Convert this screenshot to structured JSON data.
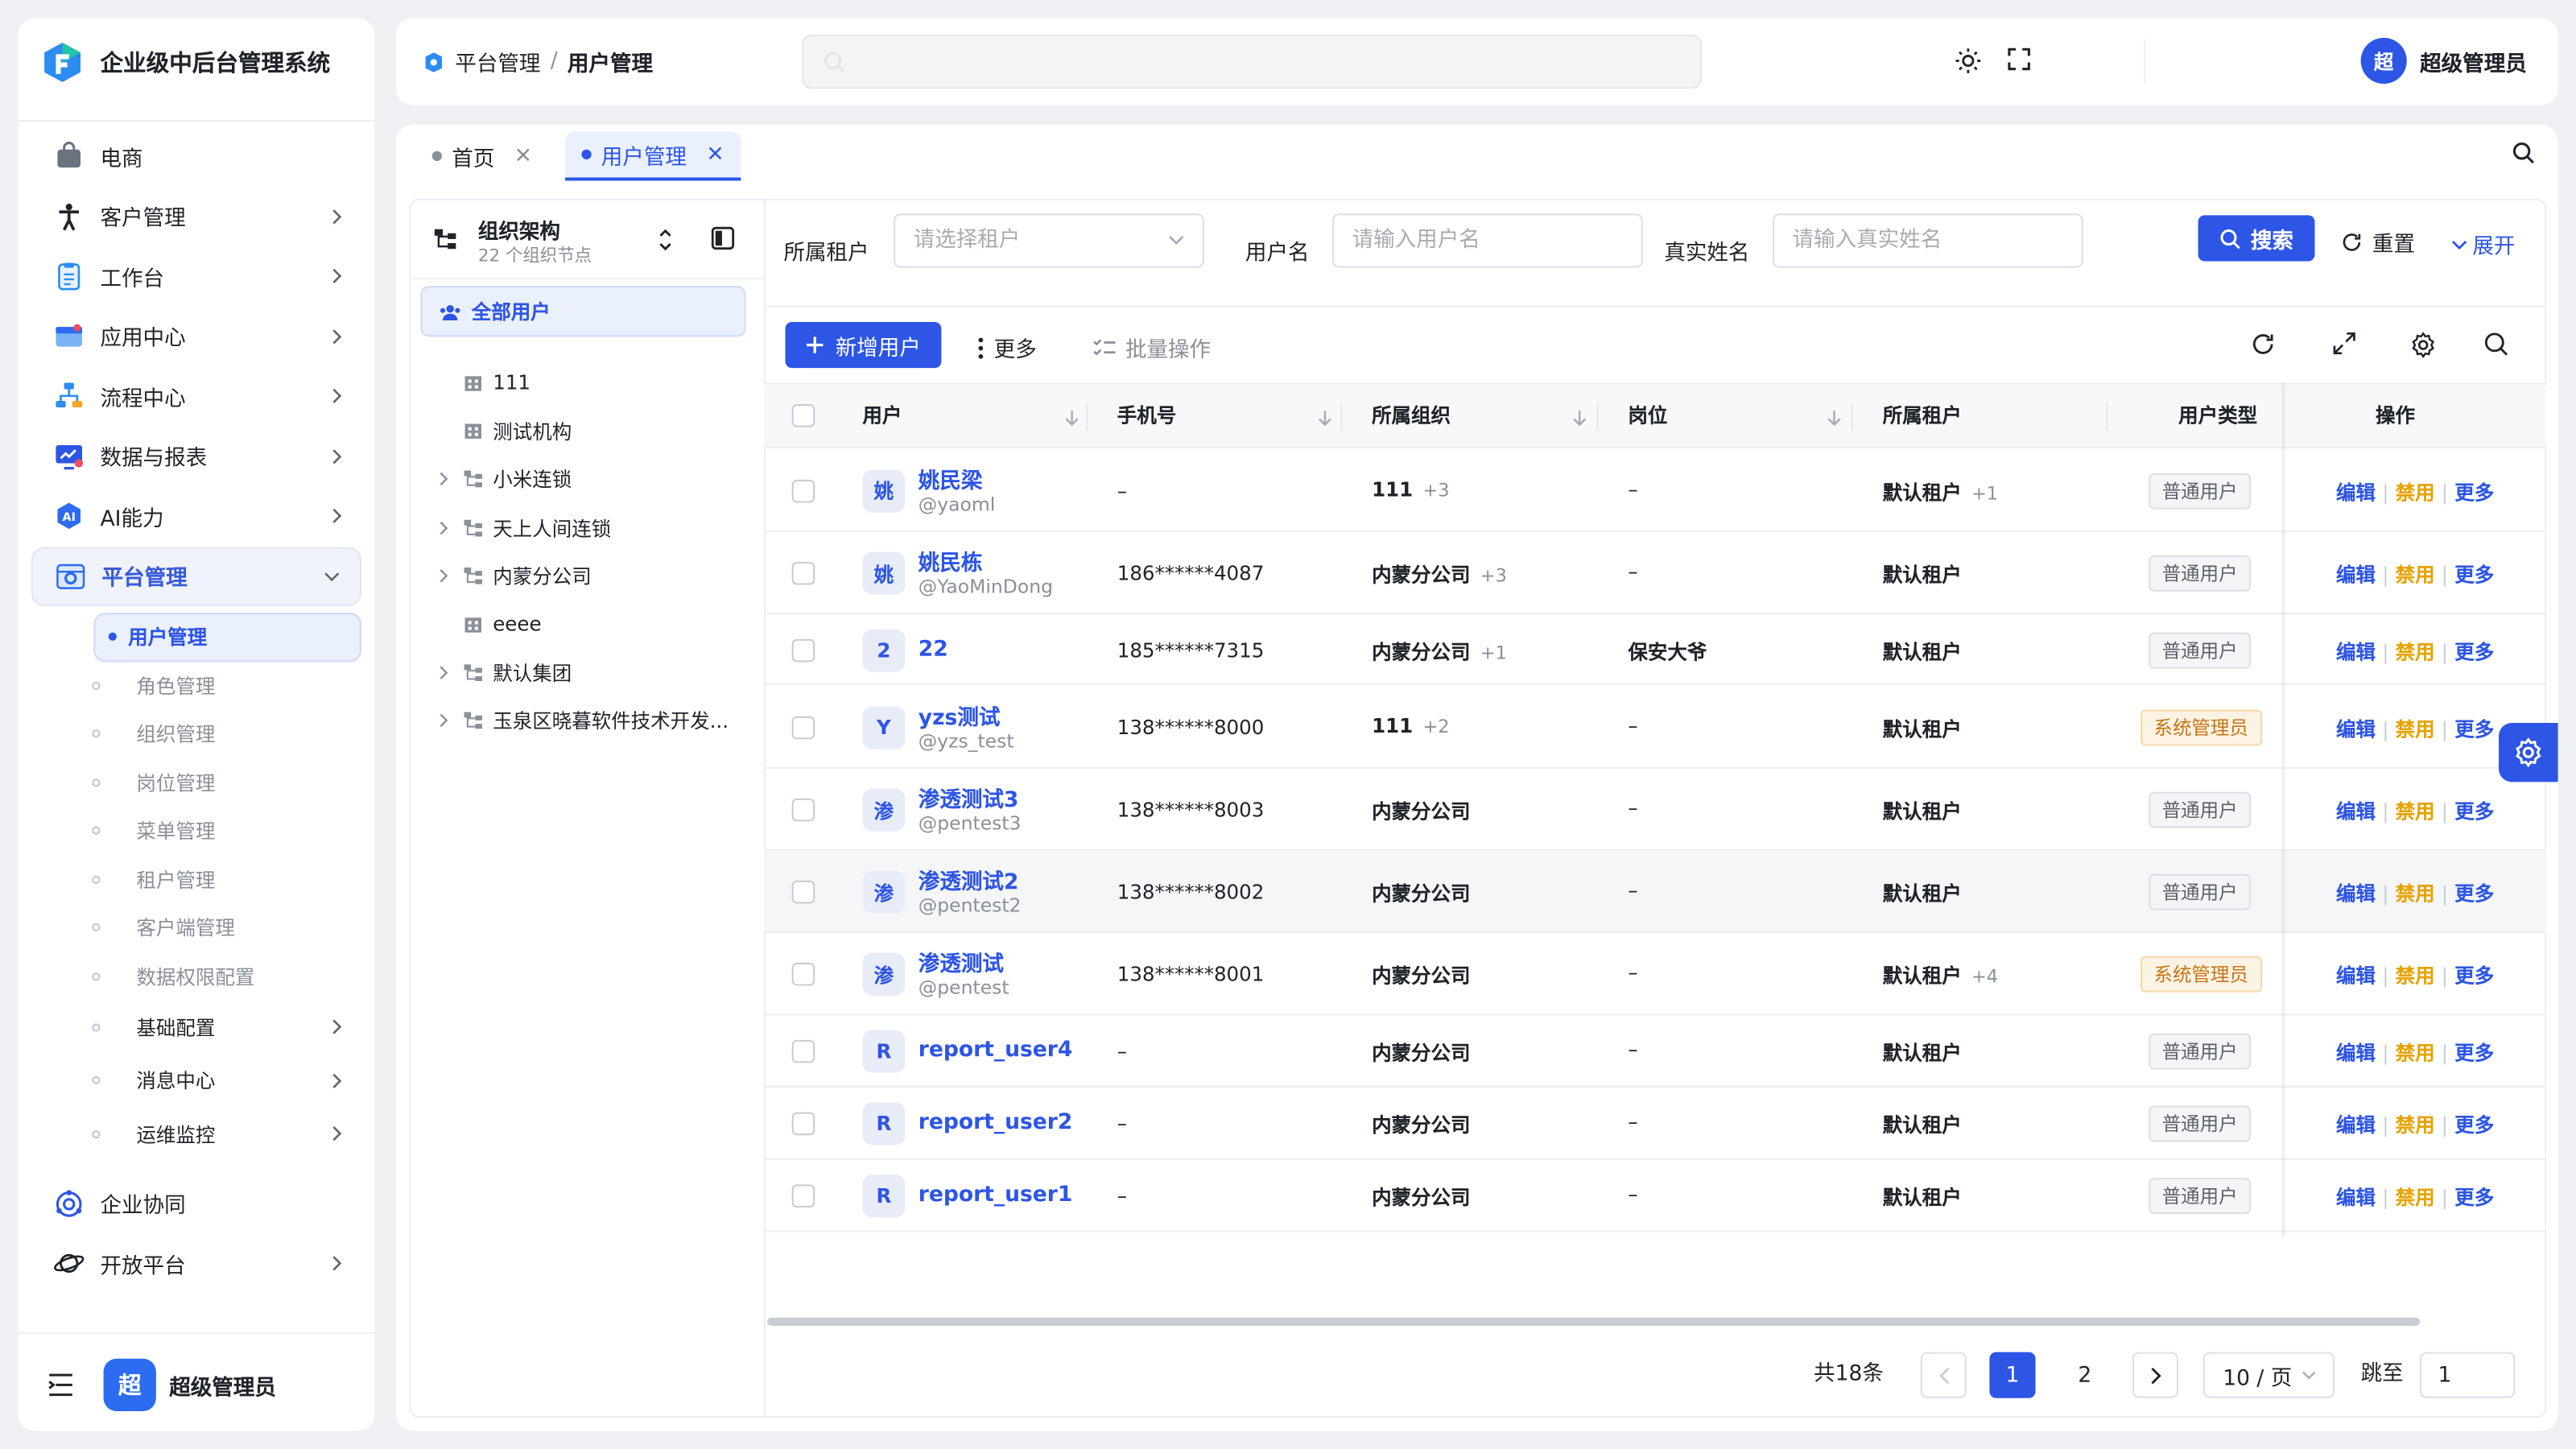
{
  "app": {
    "title": "企业级中后台管理系统"
  },
  "sidebar": {
    "items": [
      {
        "label": "电商",
        "icon": "shopping-bag-icon",
        "arrow": false
      },
      {
        "label": "客户管理",
        "icon": "person-icon",
        "arrow": true
      },
      {
        "label": "工作台",
        "icon": "clipboard-icon",
        "arrow": true
      },
      {
        "label": "应用中心",
        "icon": "app-window-icon",
        "arrow": true
      },
      {
        "label": "流程中心",
        "icon": "flow-icon",
        "arrow": true
      },
      {
        "label": "数据与报表",
        "icon": "chart-screen-icon",
        "arrow": true
      },
      {
        "label": "AI能力",
        "icon": "ai-icon",
        "arrow": true
      },
      {
        "label": "平台管理",
        "icon": "platform-gear-icon",
        "arrow": true,
        "expanded": true
      }
    ],
    "sub_items": [
      {
        "label": "用户管理",
        "active": true
      },
      {
        "label": "角色管理"
      },
      {
        "label": "组织管理"
      },
      {
        "label": "岗位管理"
      },
      {
        "label": "菜单管理"
      },
      {
        "label": "租户管理"
      },
      {
        "label": "客户端管理"
      },
      {
        "label": "数据权限配置"
      },
      {
        "label": "基础配置",
        "strong": true,
        "arrow": true
      },
      {
        "label": "消息中心",
        "strong": true,
        "arrow": true
      },
      {
        "label": "运维监控",
        "strong": true,
        "arrow": true
      }
    ],
    "bottom_items": [
      {
        "label": "企业协同",
        "icon": "collaboration-icon",
        "arrow": false
      },
      {
        "label": "开放平台",
        "icon": "planet-icon",
        "arrow": true
      }
    ],
    "footer": {
      "avatar_text": "超",
      "user_name": "超级管理员"
    }
  },
  "header": {
    "breadcrumb": [
      "平台管理",
      "用户管理"
    ],
    "user": {
      "avatar_text": "超",
      "name": "超级管理员"
    }
  },
  "tabs": [
    {
      "label": "首页",
      "active": false
    },
    {
      "label": "用户管理",
      "active": true
    }
  ],
  "tree": {
    "title": "组织架构",
    "subtitle": "22 个组织节点",
    "all_label": "全部用户",
    "nodes": [
      {
        "label": "111",
        "expandable": false,
        "icon": "building-icon"
      },
      {
        "label": "测试机构",
        "expandable": false,
        "icon": "building-icon"
      },
      {
        "label": "小米连锁",
        "expandable": true,
        "icon": "org-tree-icon"
      },
      {
        "label": "天上人间连锁",
        "expandable": true,
        "icon": "org-tree-icon"
      },
      {
        "label": "内蒙分公司",
        "expandable": true,
        "icon": "org-tree-icon"
      },
      {
        "label": "eeee",
        "expandable": false,
        "icon": "building-icon"
      },
      {
        "label": "默认集团",
        "expandable": true,
        "icon": "org-tree-icon"
      },
      {
        "label": "玉泉区晓暮软件技术开发...",
        "expandable": true,
        "icon": "org-tree-icon"
      }
    ]
  },
  "filter": {
    "tenant_label": "所属租户",
    "tenant_placeholder": "请选择租户",
    "username_label": "用户名",
    "username_placeholder": "请输入用户名",
    "realname_label": "真实姓名",
    "realname_placeholder": "请输入真实姓名",
    "search_label": "搜索",
    "reset_label": "重置",
    "expand_label": "展开"
  },
  "toolbar": {
    "add_label": "新增用户",
    "more_label": "更多",
    "batch_label": "批量操作"
  },
  "table": {
    "columns": [
      "用户",
      "手机号",
      "所属组织",
      "岗位",
      "所属租户",
      "用户类型",
      "操作"
    ],
    "rows": [
      {
        "avatar": "姚",
        "name": "姚民梁",
        "handle": "@yaoml",
        "phone": "–",
        "org": "111",
        "org_extra": "+3",
        "post": "–",
        "tenant": "默认租户",
        "tenant_extra": "+1",
        "type": "普通用户",
        "admin": false
      },
      {
        "avatar": "姚",
        "name": "姚民栋",
        "handle": "@YaoMinDong",
        "phone": "186******4087",
        "org": "内蒙分公司",
        "org_extra": "+3",
        "post": "–",
        "tenant": "默认租户",
        "tenant_extra": "",
        "type": "普通用户",
        "admin": false
      },
      {
        "avatar": "2",
        "name": "22",
        "handle": "",
        "phone": "185******7315",
        "org": "内蒙分公司",
        "org_extra": "+1",
        "post": "保安大爷",
        "tenant": "默认租户",
        "tenant_extra": "",
        "type": "普通用户",
        "admin": false
      },
      {
        "avatar": "Y",
        "name": "yzs测试",
        "handle": "@yzs_test",
        "phone": "138******8000",
        "org": "111",
        "org_extra": "+2",
        "post": "–",
        "tenant": "默认租户",
        "tenant_extra": "",
        "type": "系统管理员",
        "admin": true
      },
      {
        "avatar": "渗",
        "name": "渗透测试3",
        "handle": "@pentest3",
        "phone": "138******8003",
        "org": "内蒙分公司",
        "org_extra": "",
        "post": "–",
        "tenant": "默认租户",
        "tenant_extra": "",
        "type": "普通用户",
        "admin": false
      },
      {
        "avatar": "渗",
        "name": "渗透测试2",
        "handle": "@pentest2",
        "phone": "138******8002",
        "org": "内蒙分公司",
        "org_extra": "",
        "post": "–",
        "tenant": "默认租户",
        "tenant_extra": "",
        "type": "普通用户",
        "admin": false
      },
      {
        "avatar": "渗",
        "name": "渗透测试",
        "handle": "@pentest",
        "phone": "138******8001",
        "org": "内蒙分公司",
        "org_extra": "",
        "post": "–",
        "tenant": "默认租户",
        "tenant_extra": "+4",
        "type": "系统管理员",
        "admin": true
      },
      {
        "avatar": "R",
        "name": "report_user4",
        "handle": "",
        "phone": "–",
        "org": "内蒙分公司",
        "org_extra": "",
        "post": "–",
        "tenant": "默认租户",
        "tenant_extra": "",
        "type": "普通用户",
        "admin": false
      },
      {
        "avatar": "R",
        "name": "report_user2",
        "handle": "",
        "phone": "–",
        "org": "内蒙分公司",
        "org_extra": "",
        "post": "–",
        "tenant": "默认租户",
        "tenant_extra": "",
        "type": "普通用户",
        "admin": false
      },
      {
        "avatar": "R",
        "name": "report_user1",
        "handle": "",
        "phone": "–",
        "org": "内蒙分公司",
        "org_extra": "",
        "post": "–",
        "tenant": "默认租户",
        "tenant_extra": "",
        "type": "普通用户",
        "admin": false
      }
    ],
    "actions": {
      "edit": "编辑",
      "disable": "禁用",
      "more": "更多"
    }
  },
  "pagination": {
    "total": "共18条",
    "pages": [
      "1",
      "2"
    ],
    "current": "1",
    "page_size": "10 / 页",
    "goto_label": "跳至",
    "goto_value": "1"
  },
  "colors": {
    "primary": "#2d55e6",
    "warning": "#e6a300",
    "admin_tag": "#c57514"
  }
}
